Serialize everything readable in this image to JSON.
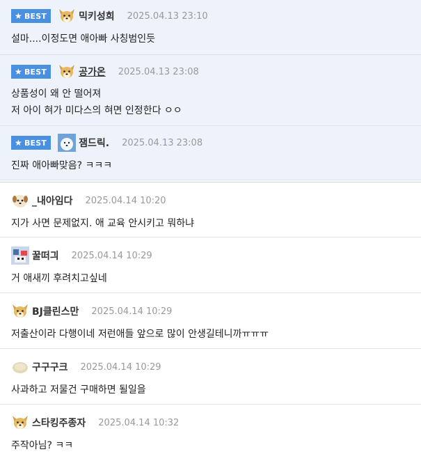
{
  "best_label": "BEST",
  "best_comments": [
    {
      "nick": "믹키성희",
      "date": "2025.04.13 23:10",
      "lines": [
        "설마....이정도면 애아빠 사칭범인듯"
      ],
      "avatar": "dog-icon"
    },
    {
      "nick": "공가온",
      "date": "2025.04.13 23:08",
      "lines": [
        "상품성이 왜 안 떨어져",
        "저 아이 혀가 미다스의 혀면 인정한다 ㅇㅇ"
      ],
      "avatar": "dog-icon"
    },
    {
      "nick": "잼드릭.",
      "date": "2025.04.13 23:08",
      "lines": [
        "진짜 애아빠맞음? ㅋㅋㅋ"
      ],
      "avatar": "photo-avatar-icon"
    }
  ],
  "comments": [
    {
      "nick": "_내아임다",
      "date": "2025.04.14 10:20",
      "text": "지가 사면 문제없지. 애 교육 안시키고 뭐하냐",
      "avatar": "puppy-icon"
    },
    {
      "nick": "꿀떠긔",
      "date": "2025.04.14 10:29",
      "text": "거 애새끼 후려치고싶네",
      "avatar": "pixel-avatar-icon"
    },
    {
      "nick": "BJ클린스만",
      "date": "2025.04.14 10:29",
      "text": "저출산이라 다행이네 저런애들 앞으로 많이 안생길테니까ㅠㅠㅠ",
      "avatar": "dog-icon"
    },
    {
      "nick": "구구구크",
      "date": "2025.04.14 10:29",
      "text": "사과하고 저물건 구매하면 될일을",
      "avatar": "blob-icon"
    },
    {
      "nick": "스타킹주종자",
      "date": "2025.04.14 10:32",
      "text": "주작아님? ㅋㅋ",
      "avatar": "dog-icon"
    }
  ]
}
